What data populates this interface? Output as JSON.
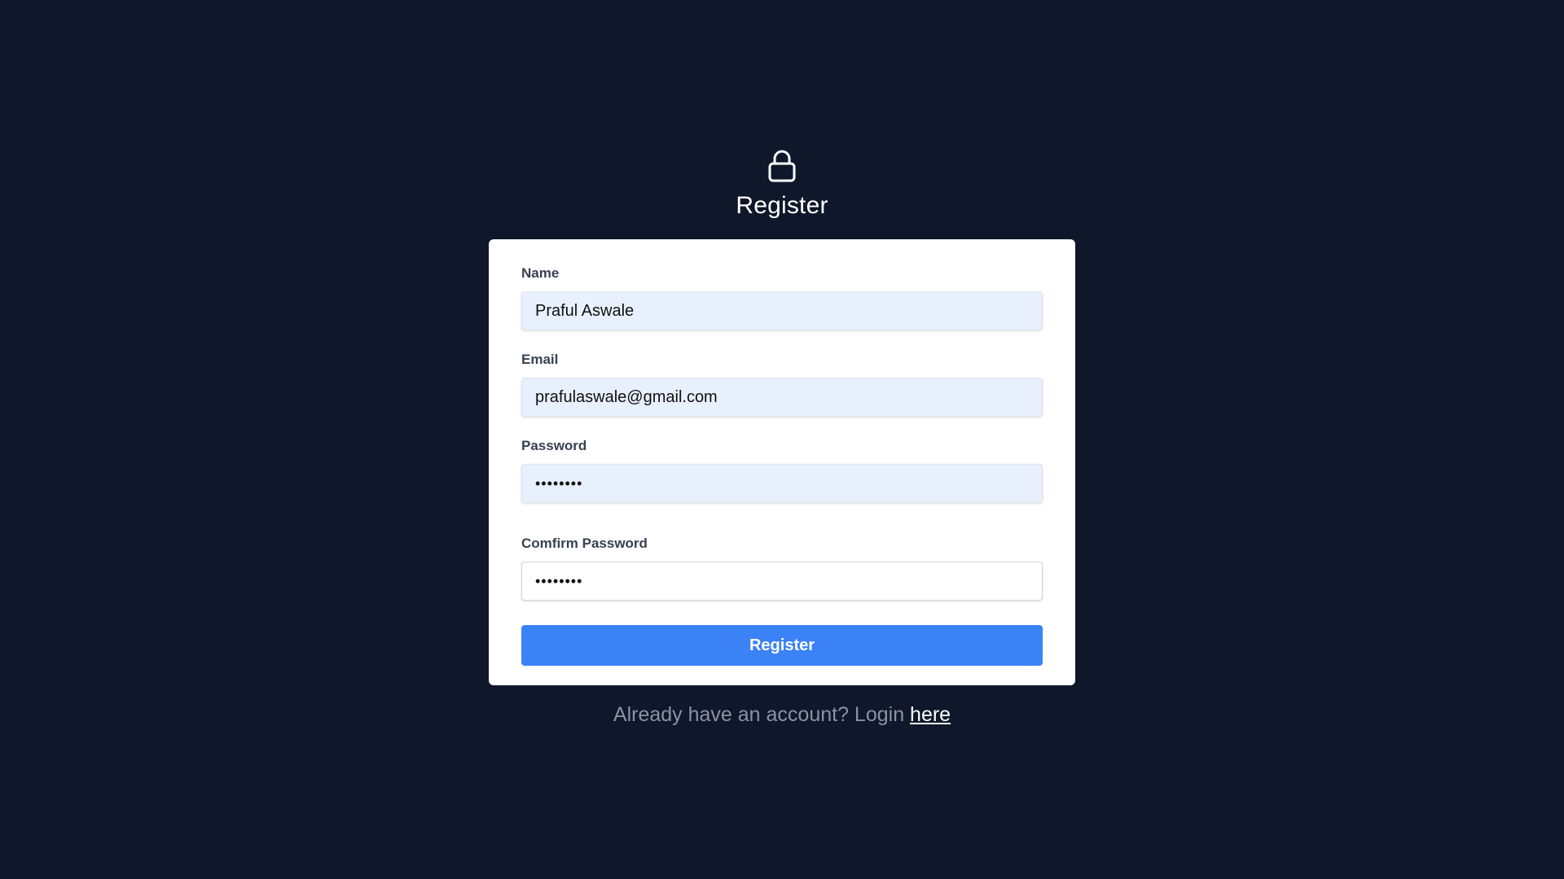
{
  "header": {
    "icon": "lock-icon",
    "title": "Register"
  },
  "form": {
    "name": {
      "label": "Name",
      "value": "Praful Aswale"
    },
    "email": {
      "label": "Email",
      "value": "prafulaswale@gmail.com"
    },
    "password": {
      "label": "Password",
      "value": "••••••••"
    },
    "confirm_password": {
      "label": "Comfirm Password",
      "value": "••••••••"
    },
    "submit_label": "Register"
  },
  "footer": {
    "text": "Already have an account? Login ",
    "link_label": "here"
  },
  "colors": {
    "background": "#0f172a",
    "card": "#ffffff",
    "autofill_input": "#e8f0fe",
    "button": "#3b82f6",
    "footer_text": "#8b92a1"
  }
}
